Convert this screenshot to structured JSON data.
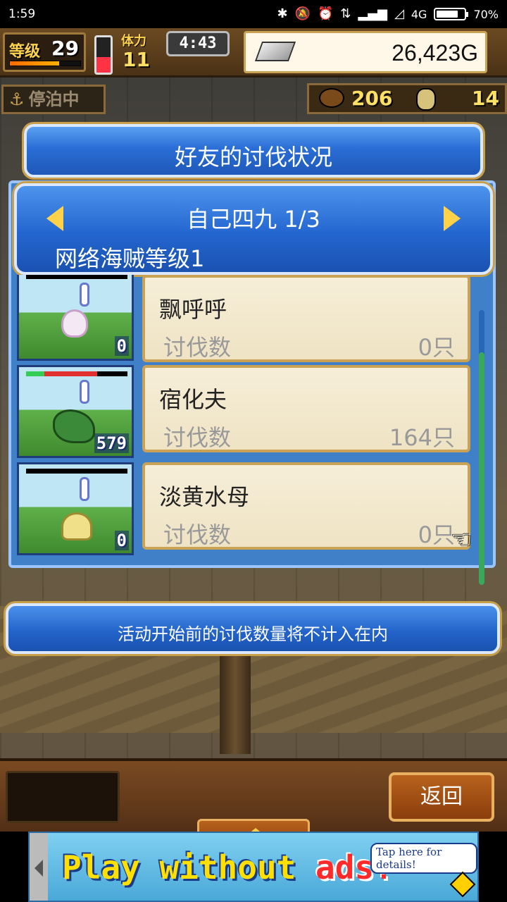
{
  "status_bar": {
    "time": "1:59",
    "network": "4G",
    "battery": "70%",
    "battery_level": 0.7
  },
  "hud": {
    "level_label": "等级",
    "level": "29",
    "level_progress": 0.7,
    "stamina_label": "体力",
    "stamina_value": "11",
    "stamina_level": 0.45,
    "clock": "4:43",
    "gold": "26,423G",
    "status_label": "停泊中",
    "resource_food": "206",
    "resource_coins": "14"
  },
  "dialog": {
    "title": "好友的讨伐状况",
    "friend_name": "自己四九 1/3",
    "friend_level": "网络海贼等级1",
    "note": "活动开始前的讨伐数量将不计入在内",
    "monsters": [
      {
        "name": "飘呼呼",
        "kills_label": "讨伐数",
        "kills": "0只",
        "thumb_count": "0",
        "hp": null
      },
      {
        "name": "宿化夫",
        "kills_label": "讨伐数",
        "kills": "164只",
        "thumb_count": "579",
        "hp": {
          "green": 0.18,
          "red": 0.52
        }
      },
      {
        "name": "淡黄水母",
        "kills_label": "讨伐数",
        "kills": "0只",
        "thumb_count": "0",
        "hp": null
      }
    ]
  },
  "bottom": {
    "back_label": "返回"
  },
  "ad": {
    "text_main": "Play without ",
    "text_accent": "ads!",
    "tap_label": "Tap here for details!"
  },
  "colors": {
    "panel_blue": "#2a6ed6",
    "card_cream": "#f6eed8",
    "gold_border": "#c9a255",
    "accent_yellow": "#ffd24a"
  }
}
